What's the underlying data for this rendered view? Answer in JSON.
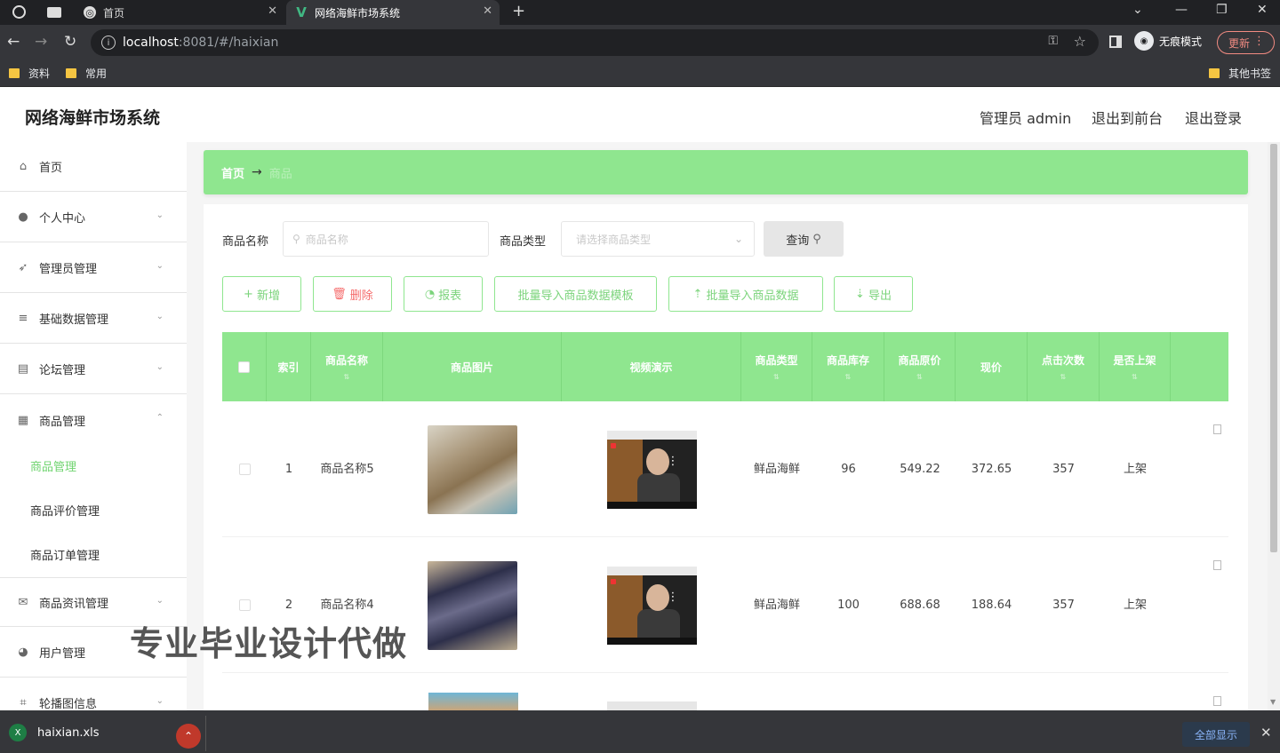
{
  "browser": {
    "tabs": [
      {
        "title": "首页",
        "active": false
      },
      {
        "title": "网络海鲜市场系统",
        "active": true
      }
    ],
    "url_host": "localhost",
    "url_rest": ":8081/#/haixian",
    "incognito_label": "无痕模式",
    "update_label": "更新",
    "bookmarks": [
      "资料",
      "常用"
    ],
    "other_bookmarks": "其他书签"
  },
  "app": {
    "title": "网络海鲜市场系统",
    "header_links": {
      "admin": "管理员 admin",
      "front": "退出到前台",
      "logout": "退出登录"
    }
  },
  "sidebar": {
    "items": [
      {
        "label": "首页",
        "icon": "home-icon"
      },
      {
        "label": "个人中心",
        "icon": "user-icon"
      },
      {
        "label": "管理员管理",
        "icon": "send-icon"
      },
      {
        "label": "基础数据管理",
        "icon": "sliders-icon"
      },
      {
        "label": "论坛管理",
        "icon": "clipboard-icon"
      },
      {
        "label": "商品管理",
        "icon": "grid-icon"
      },
      {
        "label": "商品资讯管理",
        "icon": "mail-icon"
      },
      {
        "label": "用户管理",
        "icon": "palette-icon"
      },
      {
        "label": "轮播图信息",
        "icon": "crop-icon"
      }
    ],
    "submenu": [
      "商品管理",
      "商品评价管理",
      "商品订单管理"
    ]
  },
  "breadcrumb": {
    "home": "首页",
    "separator": "→",
    "current": "商品"
  },
  "search": {
    "name_label": "商品名称",
    "name_placeholder": "商品名称",
    "type_label": "商品类型",
    "type_placeholder": "请选择商品类型",
    "query_label": "查询"
  },
  "actions": {
    "add": "新增",
    "delete": "删除",
    "report": "报表",
    "import_template": "批量导入商品数据模板",
    "import_data": "批量导入商品数据",
    "export": "导出"
  },
  "table": {
    "columns": [
      "索引",
      "商品名称",
      "商品图片",
      "视频演示",
      "商品类型",
      "商品库存",
      "商品原价",
      "现价",
      "点击次数",
      "是否上架"
    ],
    "rows": [
      {
        "index": "1",
        "name": "商品名称5",
        "type": "鲜品海鲜",
        "stock": "96",
        "orig_price": "549.22",
        "price": "372.65",
        "clicks": "357",
        "status": "上架"
      },
      {
        "index": "2",
        "name": "商品名称4",
        "type": "鲜品海鲜",
        "stock": "100",
        "orig_price": "688.68",
        "price": "188.64",
        "clicks": "357",
        "status": "上架"
      }
    ]
  },
  "watermark": "专业毕业设计代做",
  "download": {
    "filename": "haixian.xls",
    "show_all": "全部显示"
  },
  "colors": {
    "accent": "#8fe68f",
    "active_menu": "#6fd46f",
    "danger": "#f56c6c"
  }
}
